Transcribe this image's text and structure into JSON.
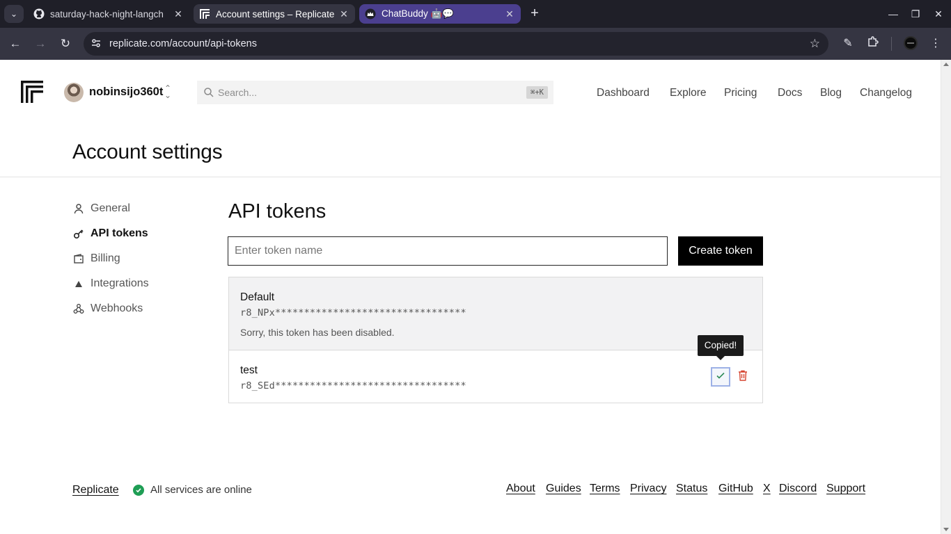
{
  "browser": {
    "tabs": [
      {
        "title": "saturday-hack-night-langch",
        "favicon": "github-icon"
      },
      {
        "title": "Account settings – Replicate",
        "favicon": "replicate-icon"
      },
      {
        "title": "ChatBuddy 🤖💬",
        "favicon": "crown-icon"
      }
    ],
    "url": "replicate.com/account/api-tokens"
  },
  "header": {
    "username": "nobinsijo360t",
    "search_placeholder": "Search...",
    "search_shortcut": "⌘+K",
    "nav": [
      "Dashboard",
      "Explore",
      "Pricing",
      "Docs",
      "Blog",
      "Changelog"
    ]
  },
  "page": {
    "title": "Account settings",
    "sidebar": [
      {
        "label": "General",
        "icon": "user-icon"
      },
      {
        "label": "API tokens",
        "icon": "key-icon",
        "active": true
      },
      {
        "label": "Billing",
        "icon": "wallet-icon"
      },
      {
        "label": "Integrations",
        "icon": "triangle-icon"
      },
      {
        "label": "Webhooks",
        "icon": "webhook-icon"
      }
    ]
  },
  "api_tokens": {
    "section_title": "API tokens",
    "input_placeholder": "Enter token name",
    "create_label": "Create token",
    "tokens": [
      {
        "name": "Default",
        "value": "r8_NPx*********************************",
        "note": "Sorry, this token has been disabled.",
        "disabled": true
      },
      {
        "name": "test",
        "value": "r8_SEd*********************************",
        "disabled": false
      }
    ],
    "tooltip": "Copied!"
  },
  "footer": {
    "brand": "Replicate",
    "status": "All services are online",
    "links": [
      "About",
      "Guides",
      "Terms",
      "Privacy",
      "Status",
      "GitHub",
      "X",
      "Discord",
      "Support"
    ]
  },
  "colors": {
    "status_green": "#1f9e55",
    "delete_red": "#d64531",
    "copy_focus": "#9db1e6"
  }
}
